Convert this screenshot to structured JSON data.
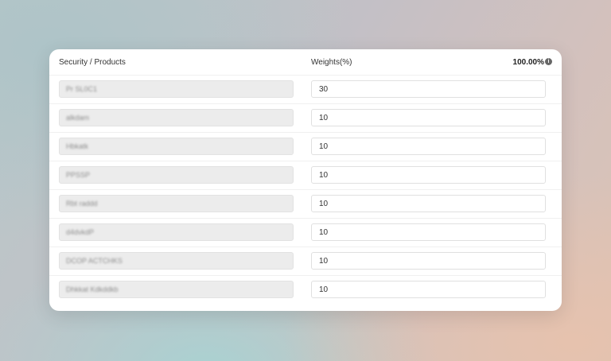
{
  "header": {
    "security_label": "Security / Products",
    "weights_label": "Weights(%)",
    "total": "100.00%",
    "info_icon": "info-icon"
  },
  "rows": [
    {
      "product": "Pr SL0C1",
      "weight": "30"
    },
    {
      "product": "alkdam",
      "weight": "10"
    },
    {
      "product": "Hbkatk",
      "weight": "10"
    },
    {
      "product": "PPSSP",
      "weight": "10"
    },
    {
      "product": "Rbt raddd",
      "weight": "10"
    },
    {
      "product": "d4dvkdP",
      "weight": "10"
    },
    {
      "product": "DCOP ACTCHKS",
      "weight": "10"
    },
    {
      "product": "Dhkkat Kdkddkb",
      "weight": "10"
    }
  ]
}
